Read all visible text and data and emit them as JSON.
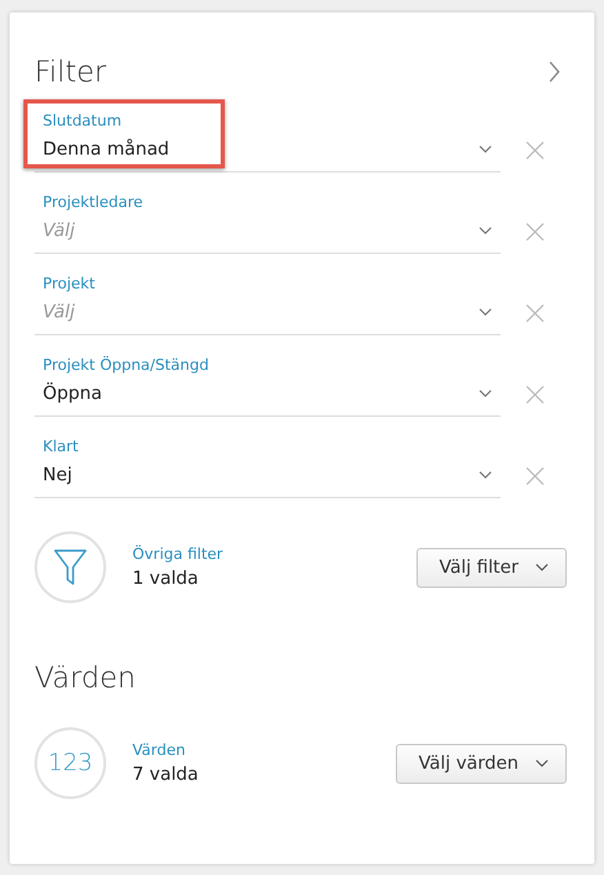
{
  "title": "Filter",
  "fields": [
    {
      "label": "Slutdatum",
      "value": "Denna månad",
      "highlighted": true
    },
    {
      "label": "Projektledare",
      "placeholder": "Välj",
      "highlighted": false
    },
    {
      "label": "Projekt",
      "placeholder": "Välj",
      "highlighted": false
    },
    {
      "label": "Projekt Öppna/Stängd",
      "value": "Öppna",
      "highlighted": false
    },
    {
      "label": "Klart",
      "value": "Nej",
      "highlighted": false
    }
  ],
  "summaries": [
    {
      "kind": "filter",
      "label": "Övriga filter",
      "count": "1 valda",
      "button": "Välj filter"
    }
  ],
  "values_section": {
    "title": "Värden",
    "summaries": [
      {
        "kind": "number",
        "icon_text": "123",
        "label": "Värden",
        "count": "7 valda",
        "button": "Välj värden"
      }
    ]
  }
}
